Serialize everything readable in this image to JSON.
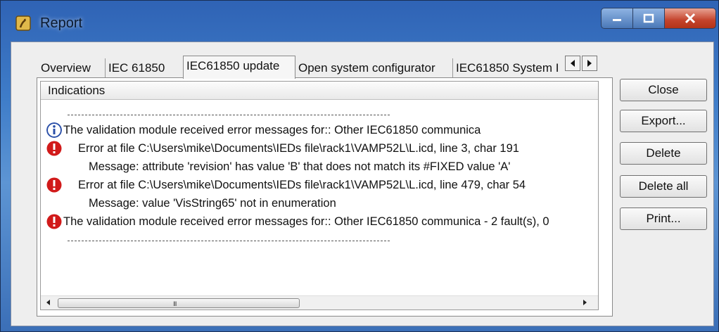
{
  "window": {
    "title": "Report"
  },
  "tabs": [
    {
      "label": "Overview",
      "active": false
    },
    {
      "label": "IEC 61850",
      "active": false
    },
    {
      "label": "IEC61850 update",
      "active": true
    },
    {
      "label": "Open system configurator",
      "active": false
    },
    {
      "label": "IEC61850 System I",
      "active": false
    }
  ],
  "list": {
    "header": "Indications",
    "rows": [
      {
        "type": "separator"
      },
      {
        "icon": "info-icon",
        "text": "The validation module received error messages for:: Other IEC61850 communica"
      },
      {
        "icon": "error-icon",
        "text": "Error at file C:\\Users\\mike\\Documents\\IEDs file\\rack1\\VAMP52L\\L.icd, line 3, char 191"
      },
      {
        "icon": "",
        "text": "Message: attribute 'revision' has value 'B' that does not match its #FIXED value 'A'"
      },
      {
        "icon": "error-icon",
        "text": "Error at file C:\\Users\\mike\\Documents\\IEDs file\\rack1\\VAMP52L\\L.icd, line 479, char 54"
      },
      {
        "icon": "",
        "text": "Message: value 'VisString65' not in enumeration"
      },
      {
        "icon": "error-icon",
        "text": "The validation module received error messages for:: Other IEC61850 communica - 2 fault(s), 0"
      },
      {
        "type": "separator"
      }
    ],
    "scroll_grip": "III"
  },
  "buttons": {
    "close": "Close",
    "export": "Export...",
    "delete": "Delete",
    "delete_all": "Delete all",
    "print": "Print..."
  },
  "colors": {
    "titlebar": "#3f7dc9",
    "error": "#d11a1a",
    "info": "#2a4fa8",
    "close_button": "#c4432b"
  }
}
